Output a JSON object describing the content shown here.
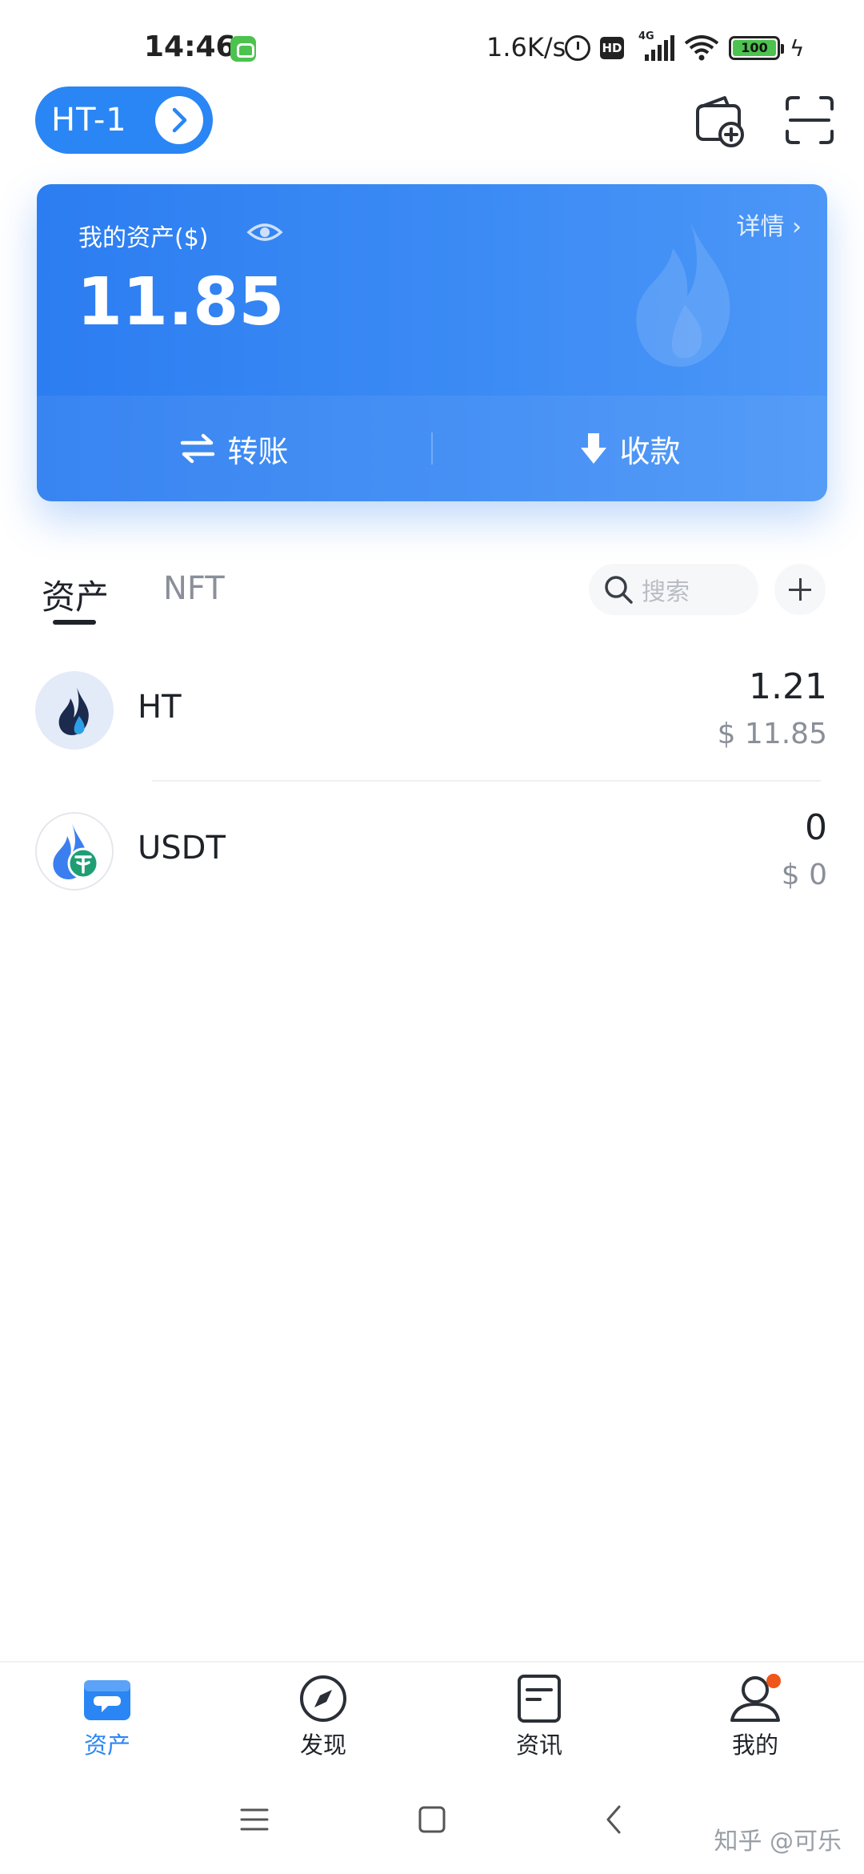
{
  "status_bar": {
    "time": "14:46",
    "network_speed": "1.6K/s",
    "network_type": "4G",
    "hd_label": "HD",
    "battery_level": "100",
    "icons": [
      "app-notification-icon",
      "alarm-icon",
      "hd-icon",
      "signal-icon",
      "wifi-icon",
      "battery-icon",
      "charging-icon"
    ]
  },
  "header": {
    "wallet_name": "HT-1",
    "icons": [
      "chevron-right-icon",
      "add-wallet-icon",
      "scan-icon"
    ]
  },
  "asset_card": {
    "label": "我的资产($)",
    "detail_link": "详情 ›",
    "total_amount": "11.85",
    "transfer_label": "转账",
    "receive_label": "收款",
    "colors": {
      "card_start": "#2c7df1",
      "card_end": "#4b96f7"
    }
  },
  "tabs": {
    "assets": "资产",
    "nft": "NFT",
    "active": "资产"
  },
  "search": {
    "placeholder": "搜索"
  },
  "tokens": [
    {
      "symbol": "HT",
      "amount": "1.21",
      "value": "$ 11.85",
      "icon": "ht-token-icon"
    },
    {
      "symbol": "USDT",
      "amount": "0",
      "value": "$ 0",
      "icon": "usdt-token-icon"
    }
  ],
  "bottom_nav": {
    "items": [
      {
        "label": "资产",
        "icon": "wallet-icon",
        "active": true
      },
      {
        "label": "发现",
        "icon": "compass-icon",
        "active": false
      },
      {
        "label": "资讯",
        "icon": "news-icon",
        "active": false
      },
      {
        "label": "我的",
        "icon": "profile-icon",
        "active": false,
        "badge": true
      }
    ],
    "accent": "#2a86f4"
  },
  "system_nav": {
    "icons": [
      "menu-icon",
      "home-icon",
      "back-icon"
    ],
    "watermark": "知乎 @可乐"
  }
}
